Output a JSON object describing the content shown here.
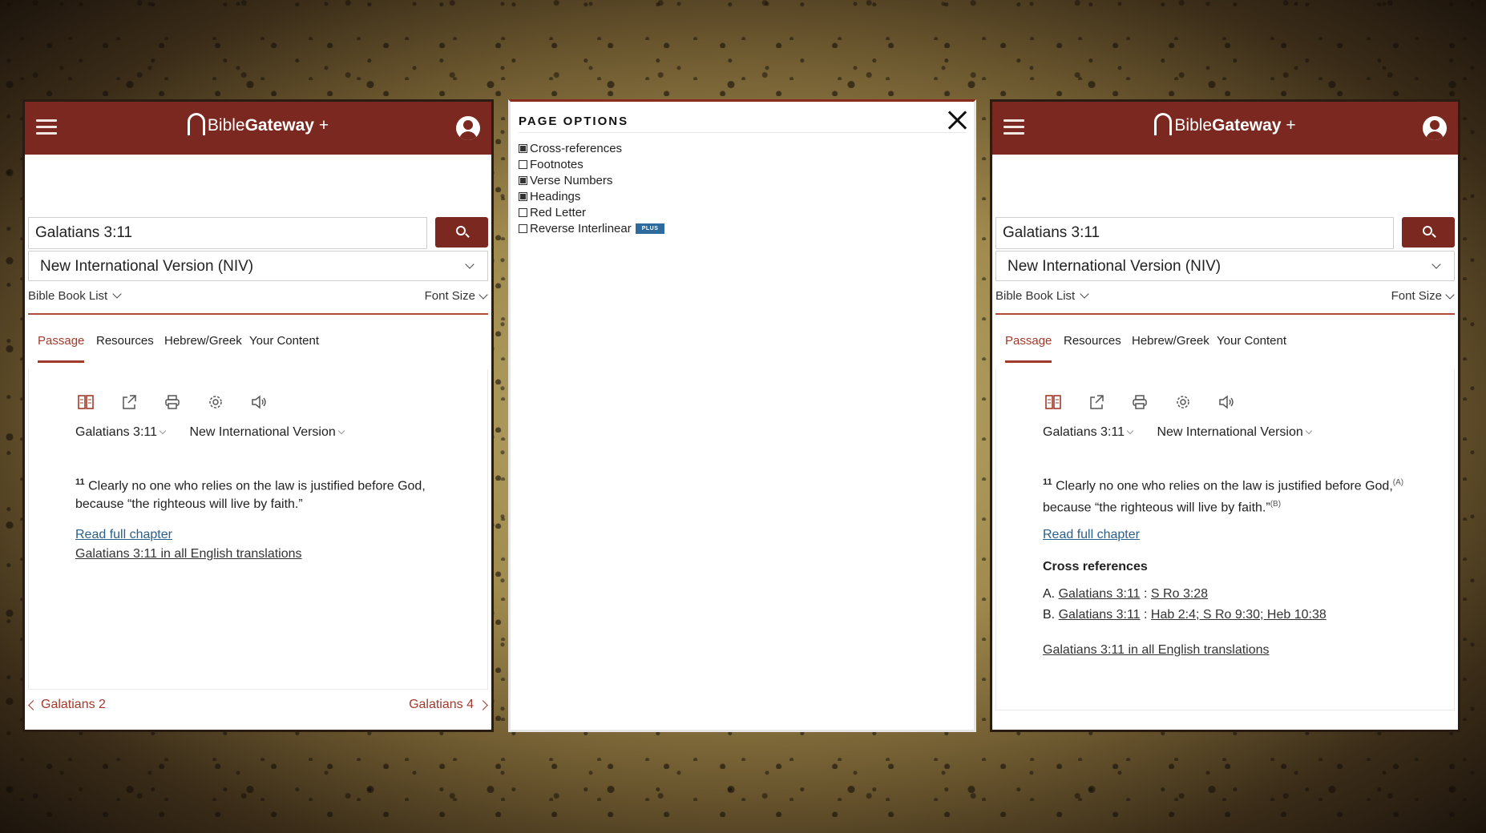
{
  "colors": {
    "brand": "#7b2920",
    "accent": "#a13a2c",
    "link": "#2b5f8a",
    "plus_badge": "#2f6a9c"
  },
  "header": {
    "logo_part1": "Bible",
    "logo_part2": "Gateway",
    "logo_plus": "+"
  },
  "left": {
    "search_value": "Galatians 3:11",
    "version": "New International Version (NIV)",
    "book_list": "Bible Book List",
    "font_size": "Font Size",
    "tabs": [
      "Passage",
      "Resources",
      "Hebrew/Greek",
      "Your Content"
    ],
    "ref_passage": "Galatians 3:11",
    "ref_version": "New International Version",
    "verse_num": "11",
    "verse_line1": "Clearly no one who relies on the law is justified before God,",
    "verse_line2": "because “the righteous will live by faith.”",
    "read_full": "Read full chapter",
    "all_translations": "Galatians 3:11 in all English translations",
    "prev": "Galatians 2",
    "next": "Galatians 4"
  },
  "page_options": {
    "title": "PAGE OPTIONS",
    "items": [
      {
        "label": "Cross-references",
        "checked": true
      },
      {
        "label": "Footnotes",
        "checked": false
      },
      {
        "label": "Verse Numbers",
        "checked": true
      },
      {
        "label": "Headings",
        "checked": true
      },
      {
        "label": "Red Letter",
        "checked": false
      },
      {
        "label": "Reverse Interlinear",
        "checked": false
      }
    ],
    "plus_badge": "PLUS"
  },
  "right": {
    "search_value": "Galatians 3:11",
    "version": "New International Version (NIV)",
    "book_list": "Bible Book List",
    "font_size": "Font Size",
    "tabs": [
      "Passage",
      "Resources",
      "Hebrew/Greek",
      "Your Content"
    ],
    "ref_passage": "Galatians 3:11",
    "ref_version": "New International Version",
    "verse_num": "11",
    "verse_line1": "Clearly no one who relies on the law is justified before God,",
    "fn_a": "(A)",
    "verse_line2": "because “the righteous will live by faith.”",
    "fn_b": "(B)",
    "read_full": "Read full chapter",
    "cross_title": "Cross references",
    "cross": [
      {
        "letter": "A.",
        "ref": "Galatians 3:11",
        "sep": " : ",
        "target": "S Ro 3:28"
      },
      {
        "letter": "B.",
        "ref": "Galatians 3:11",
        "sep": " : ",
        "target": "Hab 2:4; S Ro 9:30; Heb 10:38"
      }
    ],
    "all_translations": "Galatians 3:11 in all English translations"
  },
  "icons": [
    "parallel-icon",
    "share-icon",
    "print-icon",
    "settings-icon",
    "audio-icon"
  ]
}
